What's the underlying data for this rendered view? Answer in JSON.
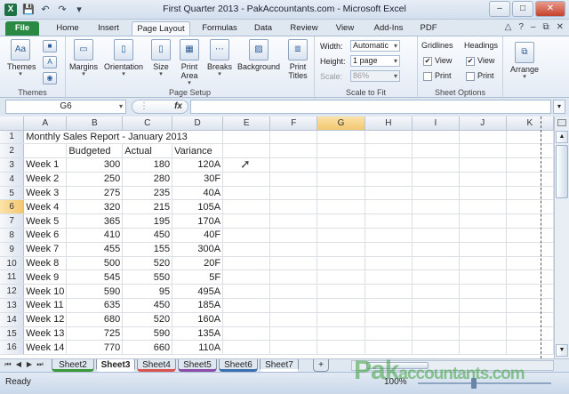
{
  "window": {
    "title": "First Quarter 2013 - PakAccountants.com - Microsoft Excel",
    "app_icon": "X",
    "controls": [
      "–",
      "□",
      "✕"
    ]
  },
  "tabs": [
    "File",
    "Home",
    "Insert",
    "Page Layout",
    "Formulas",
    "Data",
    "Review",
    "View",
    "Add-Ins",
    "PDF"
  ],
  "active_tab": "Page Layout",
  "ribbon": {
    "themes": {
      "label": "Themes",
      "group": "Themes"
    },
    "page_setup": {
      "group": "Page Setup",
      "buttons": [
        "Margins",
        "Orientation",
        "Size",
        "Print Area",
        "Breaks",
        "Background",
        "Print Titles"
      ]
    },
    "scale_to_fit": {
      "group": "Scale to Fit",
      "width_label": "Width:",
      "width_value": "Automatic",
      "height_label": "Height:",
      "height_value": "1 page",
      "scale_label": "Scale:",
      "scale_value": "86%"
    },
    "sheet_options": {
      "group": "Sheet Options",
      "gridlines": "Gridlines",
      "headings": "Headings",
      "view": "View",
      "print": "Print"
    },
    "arrange": {
      "label": "Arrange"
    }
  },
  "formula_bar": {
    "name_box": "G6",
    "fx": "fx",
    "formula": ""
  },
  "columns": [
    "A",
    "B",
    "C",
    "D",
    "E",
    "F",
    "G",
    "H",
    "I",
    "J",
    "K"
  ],
  "selected_cell": {
    "col": "G",
    "row": 6
  },
  "sheet": {
    "title": "Monthly Sales Report - January 2013",
    "headers": [
      "Budgeted",
      "Actual",
      "Variance"
    ],
    "rows": [
      [
        "Week 1",
        "300",
        "180",
        "120A"
      ],
      [
        "Week 2",
        "250",
        "280",
        "30F"
      ],
      [
        "Week 3",
        "275",
        "235",
        "40A"
      ],
      [
        "Week 4",
        "320",
        "215",
        "105A"
      ],
      [
        "Week 5",
        "365",
        "195",
        "170A"
      ],
      [
        "Week 6",
        "410",
        "450",
        "40F"
      ],
      [
        "Week 7",
        "455",
        "155",
        "300A"
      ],
      [
        "Week 8",
        "500",
        "520",
        "20F"
      ],
      [
        "Week 9",
        "545",
        "550",
        "5F"
      ],
      [
        "Week 10",
        "590",
        "95",
        "495A"
      ],
      [
        "Week 11",
        "635",
        "450",
        "185A"
      ],
      [
        "Week 12",
        "680",
        "520",
        "160A"
      ],
      [
        "Week 13",
        "725",
        "590",
        "135A"
      ],
      [
        "Week 14",
        "770",
        "660",
        "110A"
      ]
    ]
  },
  "sheet_tabs": [
    {
      "name": "Sheet2",
      "color": "#3a9a3a"
    },
    {
      "name": "Sheet3",
      "color": "#ffffff"
    },
    {
      "name": "Sheet4",
      "color": "#d9534f"
    },
    {
      "name": "Sheet5",
      "color": "#8c4fa8"
    },
    {
      "name": "Sheet6",
      "color": "#3a6fb0"
    },
    {
      "name": "Sheet7",
      "color": "#ffffff"
    }
  ],
  "active_sheet": "Sheet3",
  "status": {
    "ready": "Ready",
    "zoom": "100%"
  },
  "watermark": {
    "main": "Pak",
    "rest": "accountants.com"
  }
}
